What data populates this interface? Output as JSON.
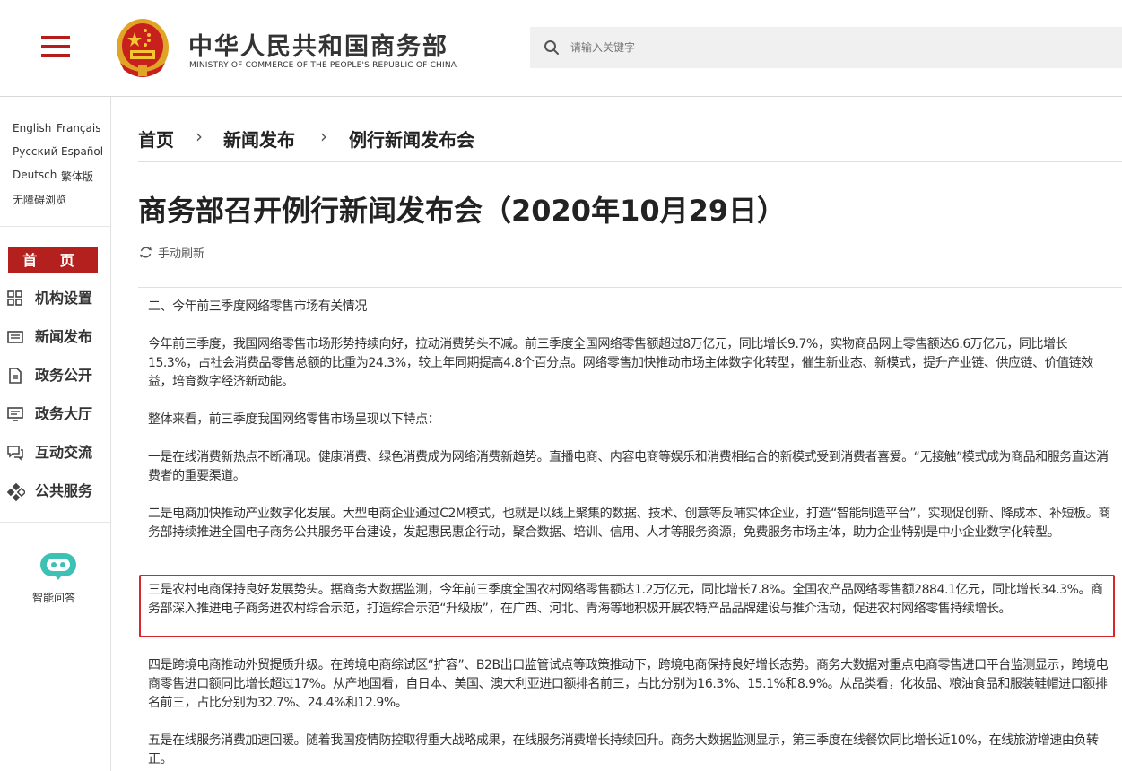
{
  "header": {
    "logo_cn": "中华人民共和国商务部",
    "logo_en": "MINISTRY OF COMMERCE OF THE PEOPLE'S REPUBLIC OF CHINA",
    "search_placeholder": "请输入关键字"
  },
  "sidebar": {
    "languages": [
      "English",
      "Français",
      "Русский",
      "Español",
      "Deutsch",
      "繁体版",
      "无障碍浏览"
    ],
    "home": "首 页",
    "nav": [
      "机构设置",
      "新闻发布",
      "政务公开",
      "政务大厅",
      "互动交流",
      "公共服务"
    ],
    "assistant": "智能问答"
  },
  "breadcrumb": [
    "首页",
    "新闻发布",
    "例行新闻发布会"
  ],
  "breadcrumb_sep": "›",
  "article": {
    "title": "商务部召开例行新闻发布会（2020年10月29日）",
    "refresh": "手动刷新",
    "paragraphs": [
      "二、今年前三季度网络零售市场有关情况",
      "今年前三季度，我国网络零售市场形势持续向好，拉动消费势头不减。前三季度全国网络零售额超过8万亿元，同比增长9.7%，实物商品网上零售额达6.6万亿元，同比增长15.3%，占社会消费品零售总额的比重为24.3%，较上年同期提高4.8个百分点。网络零售加快推动市场主体数字化转型，催生新业态、新模式，提升产业链、供应链、价值链效益，培育数字经济新动能。",
      "整体来看，前三季度我国网络零售市场呈现以下特点：",
      "一是在线消费新热点不断涌现。健康消费、绿色消费成为网络消费新趋势。直播电商、内容电商等娱乐和消费相结合的新模式受到消费者喜爱。“无接触”模式成为商品和服务直达消费者的重要渠道。",
      "二是电商加快推动产业数字化发展。大型电商企业通过C2M模式，也就是以线上聚集的数据、技术、创意等反哺实体企业，打造“智能制造平台”，实现促创新、降成本、补短板。商务部持续推进全国电子商务公共服务平台建设，发起惠民惠企行动，聚合数据、培训、信用、人才等服务资源，免费服务市场主体，助力企业特别是中小企业数字化转型。",
      "三是农村电商保持良好发展势头。据商务大数据监测，今年前三季度全国农村网络零售额达1.2万亿元，同比增长7.8%。全国农产品网络零售额2884.1亿元，同比增长34.3%。商务部深入推进电子商务进农村综合示范，打造综合示范“升级版”，在广西、河北、青海等地积极开展农特产品品牌建设与推介活动，促进农村网络零售持续增长。",
      "四是跨境电商推动外贸提质升级。在跨境电商综试区“扩容”、B2B出口监管试点等政策推动下，跨境电商保持良好增长态势。商务大数据对重点电商零售进口平台监测显示，跨境电商零售进口额同比增长超过17%。从产地国看，自日本、美国、澳大利亚进口额排名前三，占比分别为16.3%、15.1%和8.9%。从品类看，化妆品、粮油食品和服装鞋帽进口额排名前三，占比分别为32.7%、24.4%和12.9%。",
      "五是在线服务消费加速回暖。随着我国疫情防控取得重大战略成果，在线服务消费增长持续回升。商务大数据监测显示，第三季度在线餐饮同比增长近10%，在线旅游增速由负转正。"
    ]
  },
  "colors": {
    "brand_red": "#b3201d",
    "highlight_red": "#d7262c"
  }
}
